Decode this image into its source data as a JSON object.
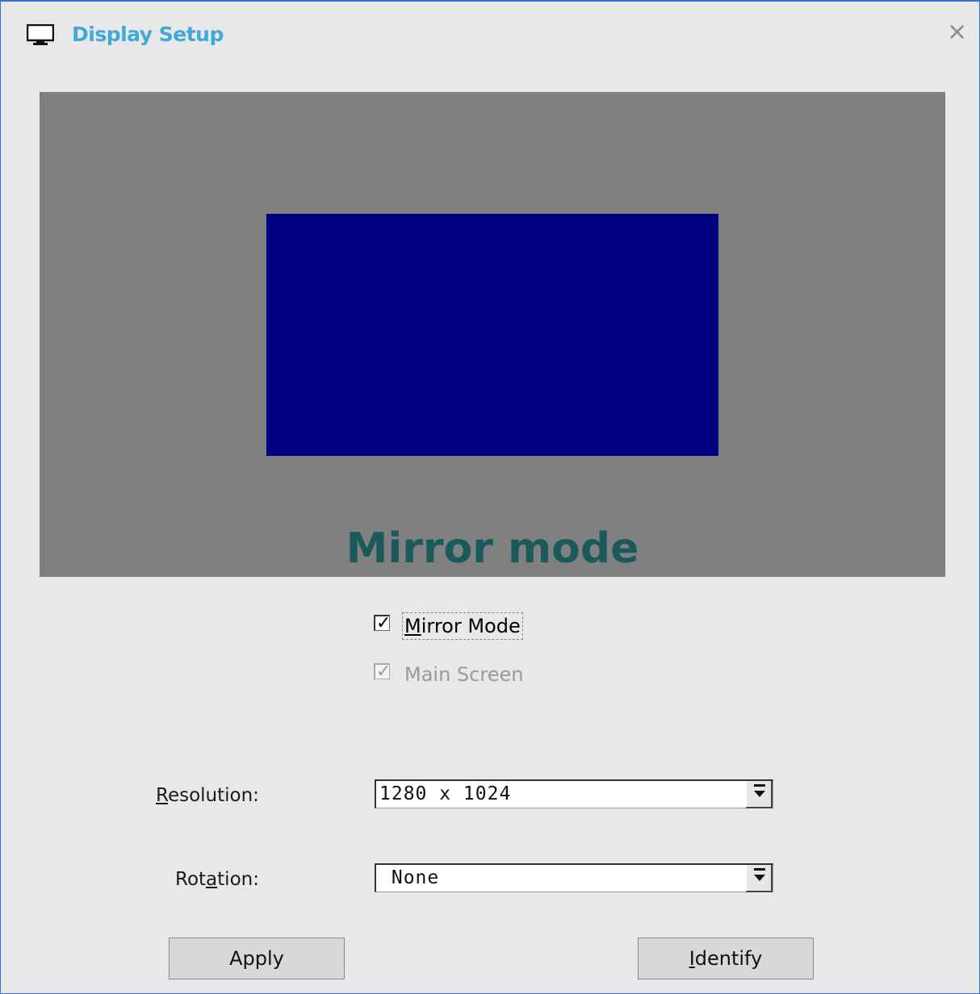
{
  "window": {
    "title": "Display Setup",
    "close_glyph": "×",
    "icon": "monitor-icon"
  },
  "preview": {
    "mode_label": "Mirror mode",
    "screen_color": "#000080",
    "background_color": "#808080"
  },
  "options": {
    "mirror_mode": {
      "label_first": "M",
      "label_rest": "irror Mode",
      "checked": true
    },
    "main_screen": {
      "label": "Main Screen",
      "checked": true,
      "disabled": true
    }
  },
  "resolution": {
    "label_first": "R",
    "label_rest": "esolution:",
    "value": "1280 x 1024"
  },
  "rotation": {
    "label_pre": "Rot",
    "label_u": "a",
    "label_post": "tion:",
    "value": " None"
  },
  "buttons": {
    "apply": "Apply",
    "identify_first": "I",
    "identify_rest": "dentify"
  },
  "colors": {
    "title": "#3fa9dc",
    "mode_label": "#1b5a5a",
    "window_border": "#3a6fd8"
  }
}
